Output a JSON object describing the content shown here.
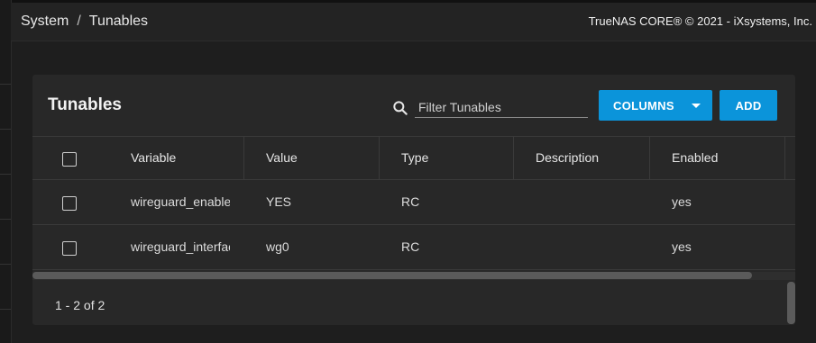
{
  "breadcrumb": {
    "section": "System",
    "separator": "/",
    "page": "Tunables"
  },
  "copyright": "TrueNAS CORE® © 2021 - iXsystems, Inc.",
  "card": {
    "title": "Tunables",
    "filter_placeholder": "Filter Tunables",
    "columns_button": "COLUMNS",
    "add_button": "ADD"
  },
  "table": {
    "columns": [
      "Variable",
      "Value",
      "Type",
      "Description",
      "Enabled"
    ],
    "rows": [
      {
        "variable": "wireguard_enable",
        "value": "YES",
        "type": "RC",
        "description": "",
        "enabled": "yes"
      },
      {
        "variable": "wireguard_interfaces",
        "value": "wg0",
        "type": "RC",
        "description": "",
        "enabled": "yes"
      }
    ]
  },
  "footer": {
    "range": "1 - 2 of 2"
  },
  "colors": {
    "accent": "#0b94da",
    "background": "#1e1e1e",
    "card": "#282828"
  }
}
